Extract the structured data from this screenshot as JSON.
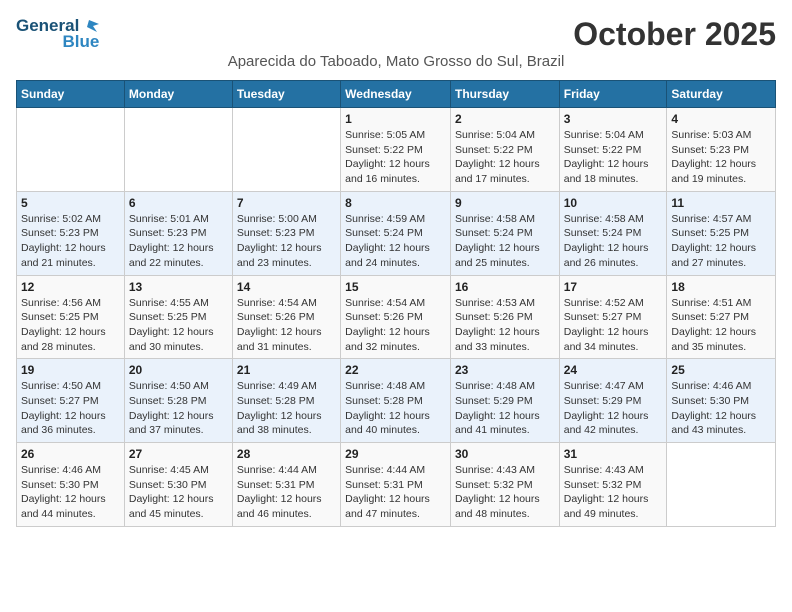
{
  "logo": {
    "line1": "General",
    "line2": "Blue"
  },
  "title": "October 2025",
  "location": "Aparecida do Taboado, Mato Grosso do Sul, Brazil",
  "days_of_week": [
    "Sunday",
    "Monday",
    "Tuesday",
    "Wednesday",
    "Thursday",
    "Friday",
    "Saturday"
  ],
  "weeks": [
    [
      {
        "day": "",
        "info": ""
      },
      {
        "day": "",
        "info": ""
      },
      {
        "day": "",
        "info": ""
      },
      {
        "day": "1",
        "info": "Sunrise: 5:05 AM\nSunset: 5:22 PM\nDaylight: 12 hours\nand 16 minutes."
      },
      {
        "day": "2",
        "info": "Sunrise: 5:04 AM\nSunset: 5:22 PM\nDaylight: 12 hours\nand 17 minutes."
      },
      {
        "day": "3",
        "info": "Sunrise: 5:04 AM\nSunset: 5:22 PM\nDaylight: 12 hours\nand 18 minutes."
      },
      {
        "day": "4",
        "info": "Sunrise: 5:03 AM\nSunset: 5:23 PM\nDaylight: 12 hours\nand 19 minutes."
      }
    ],
    [
      {
        "day": "5",
        "info": "Sunrise: 5:02 AM\nSunset: 5:23 PM\nDaylight: 12 hours\nand 21 minutes."
      },
      {
        "day": "6",
        "info": "Sunrise: 5:01 AM\nSunset: 5:23 PM\nDaylight: 12 hours\nand 22 minutes."
      },
      {
        "day": "7",
        "info": "Sunrise: 5:00 AM\nSunset: 5:23 PM\nDaylight: 12 hours\nand 23 minutes."
      },
      {
        "day": "8",
        "info": "Sunrise: 4:59 AM\nSunset: 5:24 PM\nDaylight: 12 hours\nand 24 minutes."
      },
      {
        "day": "9",
        "info": "Sunrise: 4:58 AM\nSunset: 5:24 PM\nDaylight: 12 hours\nand 25 minutes."
      },
      {
        "day": "10",
        "info": "Sunrise: 4:58 AM\nSunset: 5:24 PM\nDaylight: 12 hours\nand 26 minutes."
      },
      {
        "day": "11",
        "info": "Sunrise: 4:57 AM\nSunset: 5:25 PM\nDaylight: 12 hours\nand 27 minutes."
      }
    ],
    [
      {
        "day": "12",
        "info": "Sunrise: 4:56 AM\nSunset: 5:25 PM\nDaylight: 12 hours\nand 28 minutes."
      },
      {
        "day": "13",
        "info": "Sunrise: 4:55 AM\nSunset: 5:25 PM\nDaylight: 12 hours\nand 30 minutes."
      },
      {
        "day": "14",
        "info": "Sunrise: 4:54 AM\nSunset: 5:26 PM\nDaylight: 12 hours\nand 31 minutes."
      },
      {
        "day": "15",
        "info": "Sunrise: 4:54 AM\nSunset: 5:26 PM\nDaylight: 12 hours\nand 32 minutes."
      },
      {
        "day": "16",
        "info": "Sunrise: 4:53 AM\nSunset: 5:26 PM\nDaylight: 12 hours\nand 33 minutes."
      },
      {
        "day": "17",
        "info": "Sunrise: 4:52 AM\nSunset: 5:27 PM\nDaylight: 12 hours\nand 34 minutes."
      },
      {
        "day": "18",
        "info": "Sunrise: 4:51 AM\nSunset: 5:27 PM\nDaylight: 12 hours\nand 35 minutes."
      }
    ],
    [
      {
        "day": "19",
        "info": "Sunrise: 4:50 AM\nSunset: 5:27 PM\nDaylight: 12 hours\nand 36 minutes."
      },
      {
        "day": "20",
        "info": "Sunrise: 4:50 AM\nSunset: 5:28 PM\nDaylight: 12 hours\nand 37 minutes."
      },
      {
        "day": "21",
        "info": "Sunrise: 4:49 AM\nSunset: 5:28 PM\nDaylight: 12 hours\nand 38 minutes."
      },
      {
        "day": "22",
        "info": "Sunrise: 4:48 AM\nSunset: 5:28 PM\nDaylight: 12 hours\nand 40 minutes."
      },
      {
        "day": "23",
        "info": "Sunrise: 4:48 AM\nSunset: 5:29 PM\nDaylight: 12 hours\nand 41 minutes."
      },
      {
        "day": "24",
        "info": "Sunrise: 4:47 AM\nSunset: 5:29 PM\nDaylight: 12 hours\nand 42 minutes."
      },
      {
        "day": "25",
        "info": "Sunrise: 4:46 AM\nSunset: 5:30 PM\nDaylight: 12 hours\nand 43 minutes."
      }
    ],
    [
      {
        "day": "26",
        "info": "Sunrise: 4:46 AM\nSunset: 5:30 PM\nDaylight: 12 hours\nand 44 minutes."
      },
      {
        "day": "27",
        "info": "Sunrise: 4:45 AM\nSunset: 5:30 PM\nDaylight: 12 hours\nand 45 minutes."
      },
      {
        "day": "28",
        "info": "Sunrise: 4:44 AM\nSunset: 5:31 PM\nDaylight: 12 hours\nand 46 minutes."
      },
      {
        "day": "29",
        "info": "Sunrise: 4:44 AM\nSunset: 5:31 PM\nDaylight: 12 hours\nand 47 minutes."
      },
      {
        "day": "30",
        "info": "Sunrise: 4:43 AM\nSunset: 5:32 PM\nDaylight: 12 hours\nand 48 minutes."
      },
      {
        "day": "31",
        "info": "Sunrise: 4:43 AM\nSunset: 5:32 PM\nDaylight: 12 hours\nand 49 minutes."
      },
      {
        "day": "",
        "info": ""
      }
    ]
  ]
}
